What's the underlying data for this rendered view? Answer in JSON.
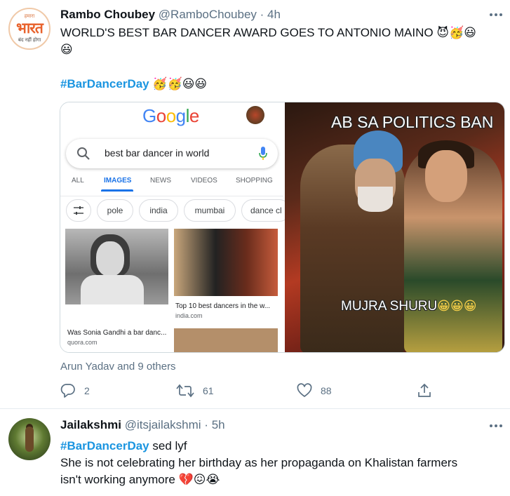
{
  "tweet1": {
    "avatar": {
      "top_text": "हमारा",
      "main_text": "भारत",
      "sub_text": "बंद नहीं होगा",
      "icon": "bharat-logo-avatar"
    },
    "name": "Rambo Choubey",
    "handle": "@RamboChoubey",
    "time": "4h",
    "text_line1": "WORLD'S BEST BAR DANCER AWARD GOES TO ANTONIO MAINO",
    "emojis_line1": "😈🥳😃",
    "emojis_line2": "😃",
    "hashtag": "#BarDancerDay",
    "hashtag_emojis": "🥳🥳😃😃",
    "media": {
      "google": {
        "logo": [
          "G",
          "o",
          "o",
          "g",
          "l",
          "e"
        ],
        "query": "best bar dancer in world",
        "tabs": [
          "ALL",
          "IMAGES",
          "NEWS",
          "VIDEOS",
          "SHOPPING"
        ],
        "chips": [
          "pole",
          "india",
          "mumbai",
          "dance cl"
        ],
        "result1_caption": "Was Sonia Gandhi a bar danc...",
        "result1_source": "quora.com",
        "result2_caption": "Top 10 best dancers in the w...",
        "result2_source": "india.com"
      },
      "meme": {
        "top_text": "AB SA POLITICS BAN",
        "bottom_text": "MUJRA SHURU",
        "bottom_emojis": "😀😀😀"
      }
    },
    "liked_by": "Arun Yadav and 9 others",
    "actions": {
      "reply_count": "2",
      "retweet_count": "61",
      "like_count": "88"
    }
  },
  "tweet2": {
    "name": "Jailakshmi",
    "handle": "@itsjailakshmi",
    "time": "5h",
    "hashtag": "#BarDancerDay",
    "hashtag_suffix": " sed lyf",
    "text_line2": "She is not celebrating her birthday as her propaganda on Khalistan farmers",
    "text_line3": "isn't working anymore",
    "emojis_line3": "💔😖😭"
  },
  "colors": {
    "accent": "#1b95e0",
    "secondary_text": "#5b7083",
    "border": "#e6ecf0"
  }
}
